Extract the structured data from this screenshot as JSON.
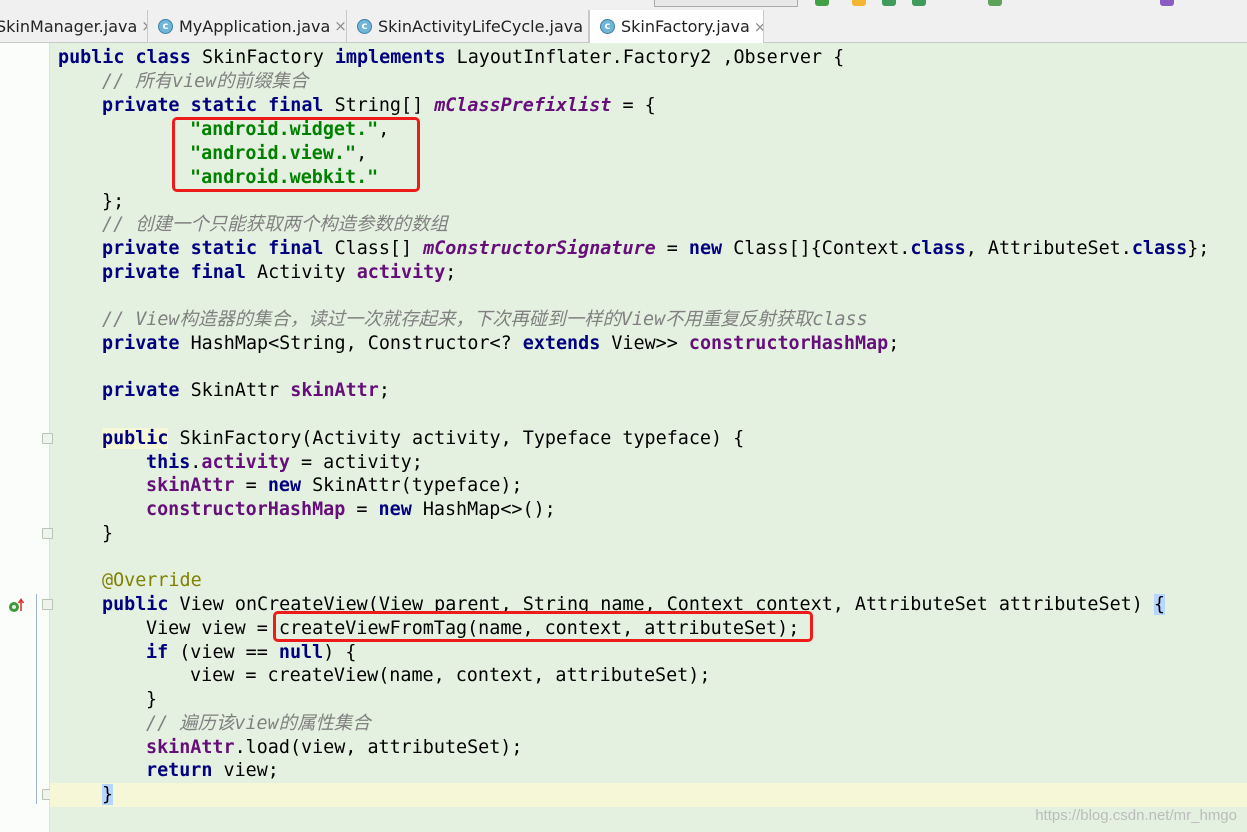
{
  "tabs": [
    {
      "label": "SkinManager.java",
      "icon": "class-icon",
      "closable": true,
      "active": false
    },
    {
      "label": "MyApplication.java",
      "icon": "class-icon",
      "closable": true,
      "active": false
    },
    {
      "label": "SkinActivityLifeCycle.java",
      "icon": "class-icon",
      "closable": true,
      "active": false
    },
    {
      "label": "SkinFactory.java",
      "icon": "class-icon",
      "closable": true,
      "active": true
    }
  ],
  "close_glyph": "×",
  "class_glyph": "c",
  "code": {
    "l1": [
      "public",
      "class",
      "SkinFactory",
      "implements",
      "LayoutInflater.Factory2 ,Observer {"
    ],
    "l2": "// 所有view的前缀集合",
    "l3": [
      "private",
      "static",
      "final",
      "String[]",
      "mClassPrefixlist",
      "= {"
    ],
    "l4": [
      "\"android.widget.\"",
      ","
    ],
    "l5": [
      "\"android.view.\"",
      ","
    ],
    "l6": [
      "\"android.webkit.\""
    ],
    "l7": "};",
    "l8": "// 创建一个只能获取两个构造参数的数组",
    "l9": [
      "private",
      "static",
      "final",
      "Class[]",
      "mConstructorSignature",
      "=",
      "new",
      "Class[]{Context.",
      "class",
      ", AttributeSet.",
      "class",
      "};"
    ],
    "l10": [
      "private",
      "final",
      "Activity",
      "activity",
      ";"
    ],
    "l11": "// View构造器的集合，读过一次就存起来，下次再碰到一样的View不用重复反射获取class",
    "l12": [
      "private",
      "HashMap<String, Constructor<?",
      "extends",
      "View>>",
      "constructorHashMap",
      ";"
    ],
    "l13": [
      "private",
      "SkinAttr",
      "skinAttr",
      ";"
    ],
    "l14": [
      "public",
      "SkinFactory(Activity activity, Typeface typeface) {"
    ],
    "l15": [
      "this",
      ".",
      "activity",
      " = activity;"
    ],
    "l16": [
      "skinAttr",
      " =",
      "new",
      "SkinAttr(typeface);"
    ],
    "l17": [
      "constructorHashMap",
      " =",
      "new",
      "HashMap<>();"
    ],
    "l18": "}",
    "l19": "@Override",
    "l20": [
      "public",
      "View onCreateView(View parent, String name, Context context, AttributeSet attributeSet)",
      "{"
    ],
    "l21": [
      "View view =",
      "createViewFromTag(name, context, attributeSet);"
    ],
    "l22": [
      "if",
      "(view ==",
      "null",
      ") {"
    ],
    "l23": "view = createView(name, context, attributeSet);",
    "l24": "}",
    "l25": "// 遍历该view的属性集合",
    "l26": [
      "skinAttr",
      ".load(view, attributeSet);"
    ],
    "l27": [
      "return",
      "view;"
    ],
    "l28": "}"
  },
  "watermark": "https://blog.csdn.net/mr_hmgo",
  "colors": {
    "keyword": "#000080",
    "string": "#008000",
    "field": "#660e7a",
    "comment": "#808080",
    "annotation": "#808000",
    "highlight_box": "#ee1b1b",
    "editor_bg": "#e4f1e0"
  }
}
